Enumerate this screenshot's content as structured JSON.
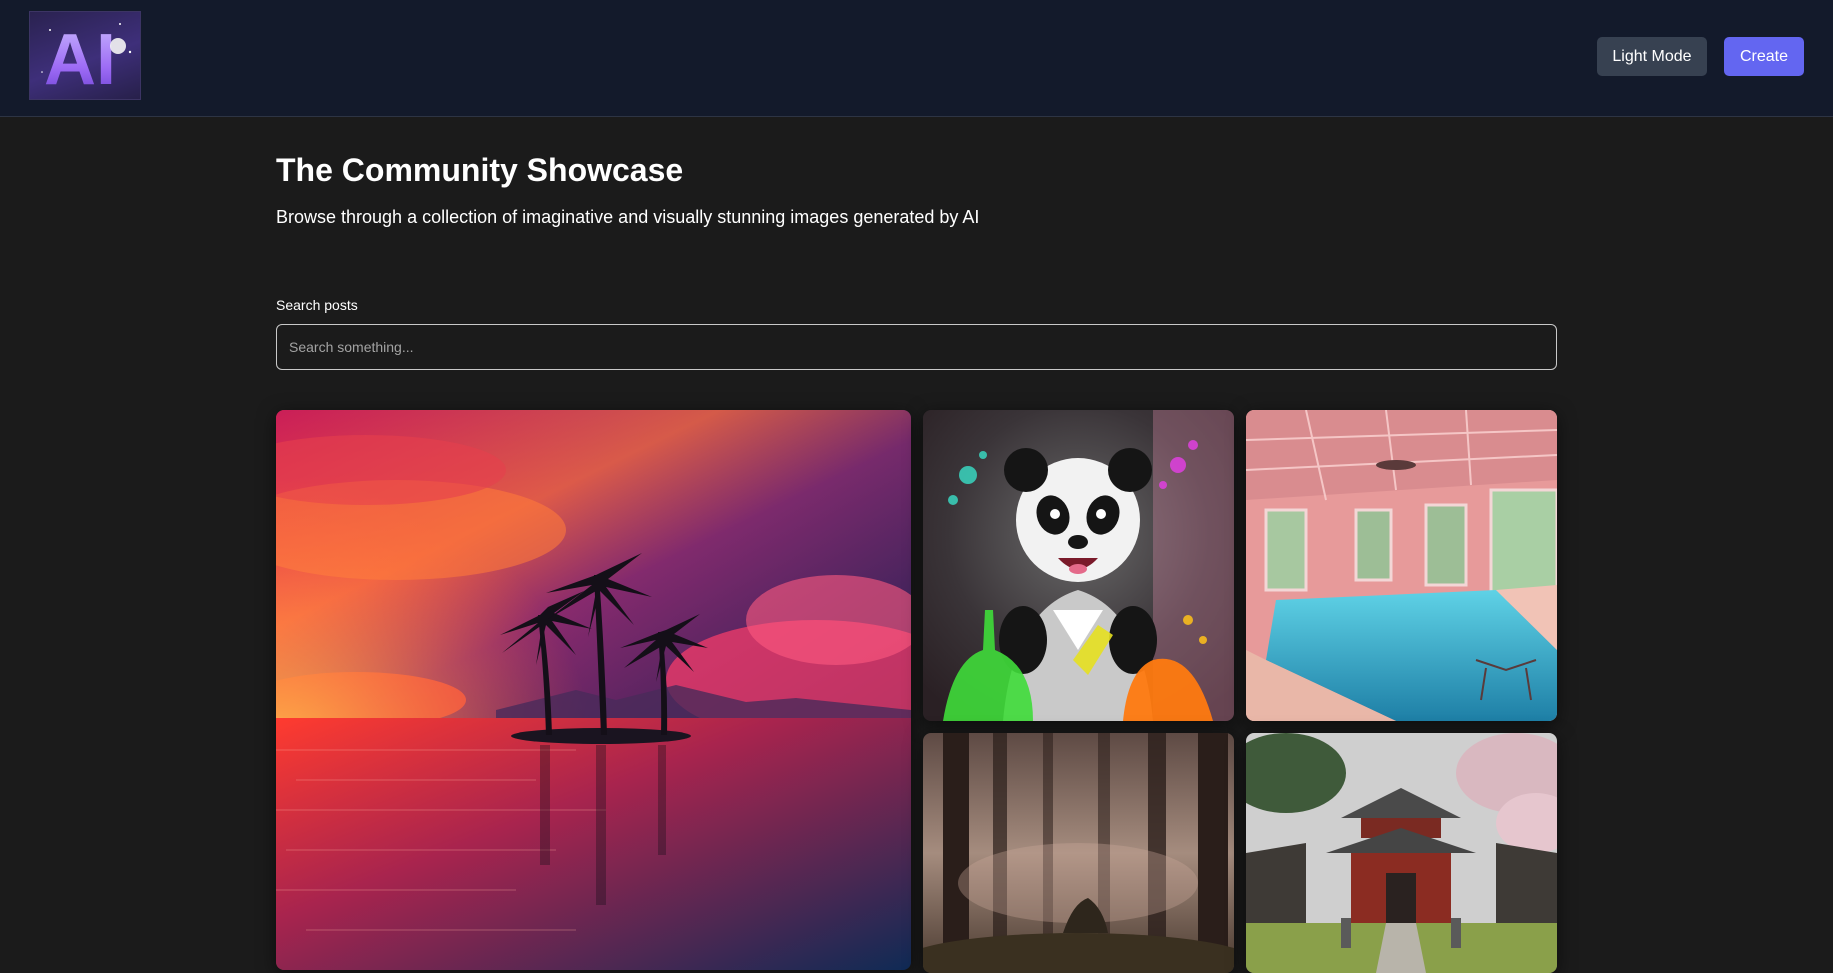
{
  "header": {
    "logo_text": "AI",
    "light_mode_label": "Light Mode",
    "create_label": "Create"
  },
  "main": {
    "title": "The Community Showcase",
    "subtitle": "Browse through a collection of imaginative and visually stunning images generated by AI",
    "search": {
      "label": "Search posts",
      "placeholder": "Search something...",
      "value": ""
    }
  },
  "gallery": {
    "items": [
      {
        "subject": "palm-island-sunset"
      },
      {
        "subject": "panda-scientist"
      },
      {
        "subject": "indoor-pool"
      },
      {
        "subject": "misty-forest"
      },
      {
        "subject": "japanese-temple"
      }
    ]
  },
  "colors": {
    "header_bg": "#131a2b",
    "page_bg": "#1b1b1b",
    "accent": "#6366f1",
    "secondary_button": "#374151"
  }
}
